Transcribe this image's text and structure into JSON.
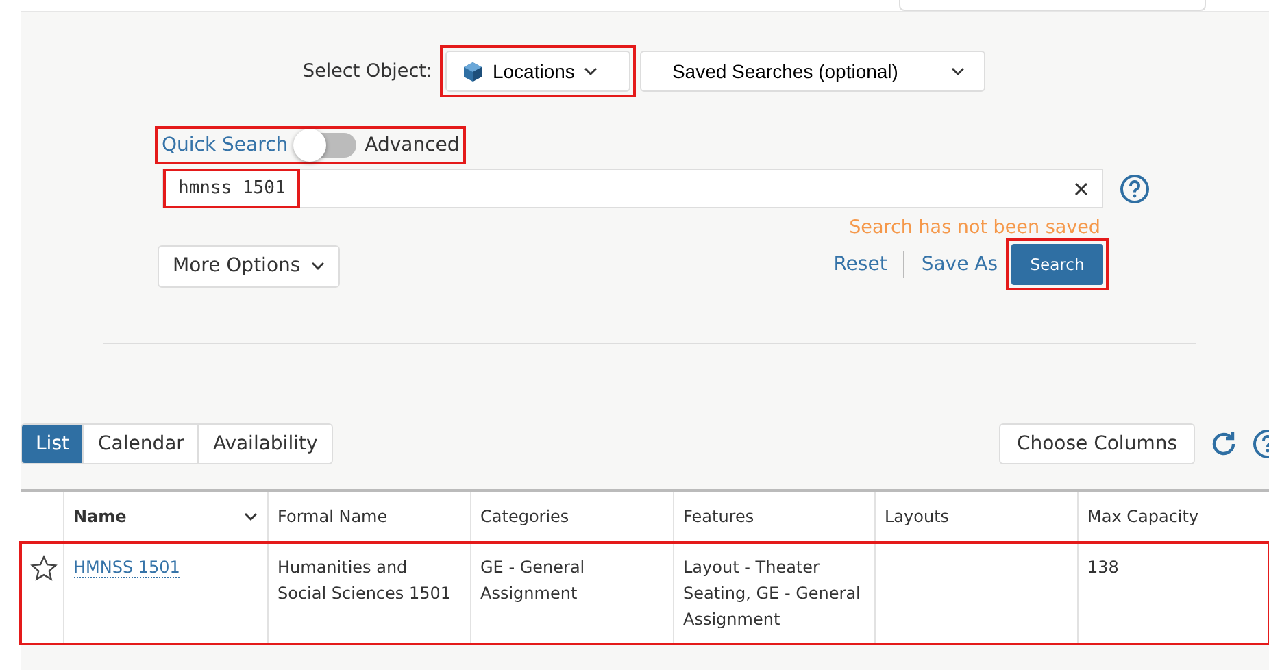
{
  "select_object": {
    "label": "Select Object:",
    "object": {
      "value": "Locations",
      "highlighted": true
    },
    "saved_searches": {
      "value": "Saved Searches (optional)"
    }
  },
  "mode": {
    "quick_label": "Quick Search",
    "advanced_label": "Advanced",
    "advanced": false,
    "highlighted": true
  },
  "search_field": {
    "value": "hmnss 1501",
    "highlighted": true
  },
  "save_status": "Search has not been saved",
  "more_options": "More Options",
  "actions": {
    "reset": "Reset",
    "save_as": "Save As",
    "search": {
      "label": "Search",
      "highlighted": true
    }
  },
  "view_tabs": [
    {
      "label": "List",
      "selected": true
    },
    {
      "label": "Calendar",
      "selected": false
    },
    {
      "label": "Availability",
      "selected": false
    }
  ],
  "choose_columns": "Choose Columns",
  "table": {
    "columns": [
      "Name",
      "Formal Name",
      "Categories",
      "Features",
      "Layouts",
      "Max Capacity"
    ],
    "rows": [
      {
        "starred": false,
        "highlighted": true,
        "cells": [
          "HMNSS 1501",
          "Humanities and Social Sciences 1501",
          "GE - General Assignment",
          "Layout - Theater Seating, GE - General Assignment",
          "",
          "138"
        ]
      }
    ]
  }
}
